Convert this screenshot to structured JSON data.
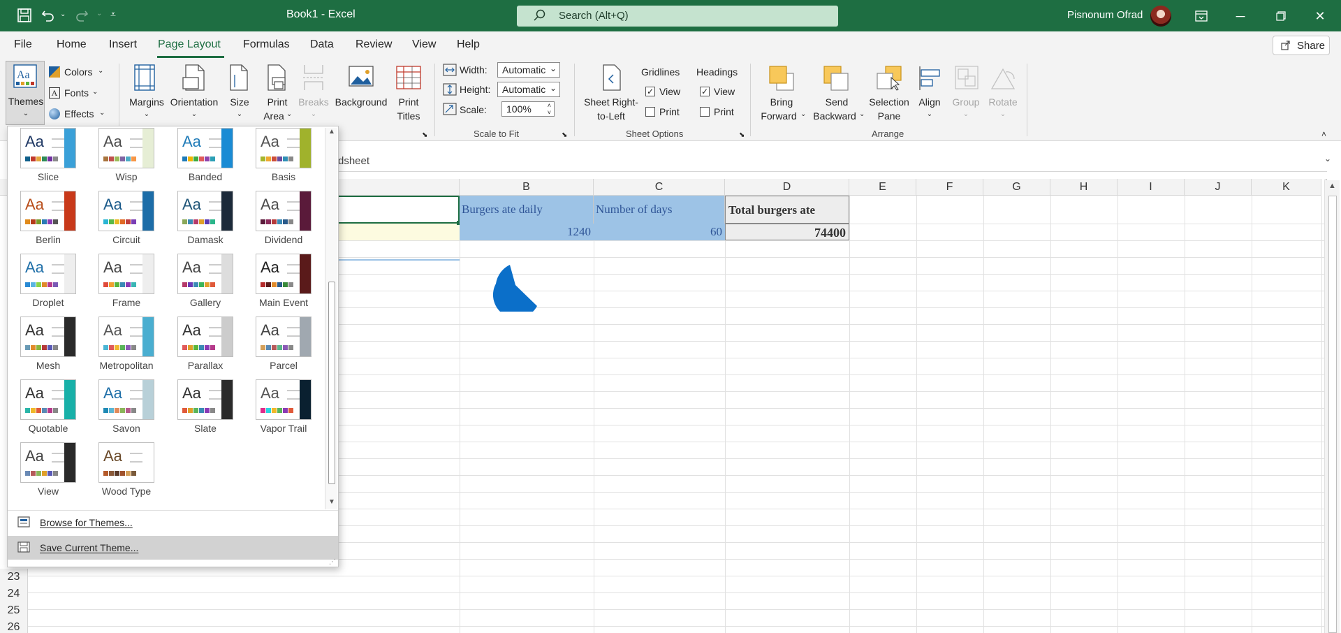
{
  "titlebar": {
    "title": "Book1  -  Excel",
    "search_placeholder": "Search (Alt+Q)",
    "user_name": "Pisnonum Ofrad"
  },
  "menu": {
    "tabs": [
      "File",
      "Home",
      "Insert",
      "Page Layout",
      "Formulas",
      "Data",
      "Review",
      "View",
      "Help"
    ],
    "active_tab": "Page Layout",
    "share_label": "Share"
  },
  "ribbon": {
    "themes": {
      "themes_label": "Themes",
      "colors_label": "Colors",
      "fonts_label": "Fonts",
      "effects_label": "Effects"
    },
    "page_setup": {
      "margins": "Margins",
      "orientation": "Orientation",
      "size": "Size",
      "print_area_1": "Print",
      "print_area_2": "Area",
      "breaks": "Breaks",
      "background": "Background",
      "print_titles_1": "Print",
      "print_titles_2": "Titles"
    },
    "scale_to_fit": {
      "width_label": "Width:",
      "width_value": "Automatic",
      "height_label": "Height:",
      "height_value": "Automatic",
      "scale_label": "Scale:",
      "scale_value": "100%",
      "group_label": "Scale to Fit"
    },
    "sheet_options": {
      "rtl_1": "Sheet Right-",
      "rtl_2": "to-Left",
      "gridlines": "Gridlines",
      "headings": "Headings",
      "view": "View",
      "print": "Print",
      "gridlines_view_checked": true,
      "gridlines_print_checked": false,
      "headings_view_checked": true,
      "headings_print_checked": false,
      "group_label": "Sheet Options"
    },
    "arrange": {
      "bring_1": "Bring",
      "bring_2": "Forward",
      "send_1": "Send",
      "send_2": "Backward",
      "sel_1": "Selection",
      "sel_2": "Pane",
      "align": "Align",
      "group": "Group",
      "rotate": "Rotate",
      "group_label": "Arrange"
    }
  },
  "formula_bar": {
    "content": "dsheet"
  },
  "grid": {
    "columns": [
      "B",
      "C",
      "D",
      "E",
      "F",
      "G",
      "H",
      "I",
      "J",
      "K"
    ],
    "visible_rows": [
      "23",
      "24",
      "25",
      "26"
    ],
    "cells": {
      "b1": "Burgers ate daily",
      "c1": "Number of days",
      "d1": "Total burgers ate",
      "b2": "1240",
      "c2": "60",
      "d2": "74400"
    }
  },
  "themes_panel": {
    "themes": [
      {
        "name": "Slice",
        "aa": "#1f3864",
        "side": "#3aa0d8",
        "colors": [
          "#0f5f8a",
          "#c0392b",
          "#e6a53a",
          "#2e8b57",
          "#7030a0",
          "#8a8a8a"
        ]
      },
      {
        "name": "Wisp",
        "aa": "#4d4d4d",
        "side": "#e6eed5",
        "colors": [
          "#a9743d",
          "#c0504d",
          "#9bbb59",
          "#8064a2",
          "#4bacc6",
          "#f79646"
        ]
      },
      {
        "name": "Banded",
        "aa": "#1f7bb8",
        "side": "#1a8bd4",
        "colors": [
          "#1f7bb8",
          "#f0b400",
          "#3eaa3e",
          "#e05a5a",
          "#8e44ad",
          "#2c9fb5"
        ]
      },
      {
        "name": "Basis",
        "aa": "#555555",
        "side": "#a0b22c",
        "colors": [
          "#a5b52c",
          "#f0a830",
          "#cc4e3b",
          "#6c4a9e",
          "#2f8fb5",
          "#888888"
        ]
      },
      {
        "name": "Berlin",
        "aa": "#b84d1a",
        "side": "#c8391a",
        "colors": [
          "#e08a1a",
          "#b53a1a",
          "#7a9a2a",
          "#2a7ab5",
          "#8a3ab5",
          "#555555"
        ]
      },
      {
        "name": "Circuit",
        "aa": "#1a5a8a",
        "side": "#1c6da8",
        "colors": [
          "#2ab5d4",
          "#57b847",
          "#e8b923",
          "#e06926",
          "#bf3e3e",
          "#7a3eb5"
        ]
      },
      {
        "name": "Damask",
        "aa": "#1f5577",
        "side": "#1c2a3a",
        "colors": [
          "#8aa85a",
          "#3a8ab5",
          "#b53a6a",
          "#e0a02a",
          "#5a3ab5",
          "#2ab58a"
        ]
      },
      {
        "name": "Dividend",
        "aa": "#4d4d4d",
        "side": "#5a1a3a",
        "colors": [
          "#5a1a3a",
          "#8a2a5a",
          "#b53a3a",
          "#3a8ab5",
          "#2a5a8a",
          "#888888"
        ]
      },
      {
        "name": "Droplet",
        "aa": "#1f6fa8",
        "side": "#eeeeee",
        "colors": [
          "#2a8ad4",
          "#5ab5e0",
          "#8ad44a",
          "#e08a2a",
          "#b53a8a",
          "#7a5ab5"
        ]
      },
      {
        "name": "Frame",
        "aa": "#444444",
        "side": "#eeeeee",
        "colors": [
          "#e04a3a",
          "#f0a030",
          "#5ab53a",
          "#3a8ab5",
          "#8a3ab5",
          "#3ab5b5"
        ]
      },
      {
        "name": "Gallery",
        "aa": "#444444",
        "side": "#dddddd",
        "colors": [
          "#b53a6a",
          "#6a3ab5",
          "#3a8ab5",
          "#3ab55a",
          "#e0a02a",
          "#e05a3a"
        ]
      },
      {
        "name": "Main Event",
        "aa": "#222222",
        "side": "#5a1a1a",
        "colors": [
          "#b52a2a",
          "#5a1a1a",
          "#e08a2a",
          "#2a5a8a",
          "#3a8a3a",
          "#8a8a8a"
        ]
      },
      {
        "name": "Mesh",
        "aa": "#333333",
        "side": "#2a2a2a",
        "colors": [
          "#6a9ab5",
          "#e08a2a",
          "#8ab53a",
          "#b53a3a",
          "#5a5ab5",
          "#888888"
        ]
      },
      {
        "name": "Metropolitan",
        "aa": "#555555",
        "side": "#4aaed0",
        "colors": [
          "#4ab5d4",
          "#e05a5a",
          "#f0b830",
          "#5ab55a",
          "#8a5ab5",
          "#888888"
        ]
      },
      {
        "name": "Parallax",
        "aa": "#333333",
        "side": "#cccccc",
        "colors": [
          "#e05a5a",
          "#e0a02a",
          "#5ab53a",
          "#3a8ab5",
          "#8a3ab5",
          "#b53a8a"
        ]
      },
      {
        "name": "Parcel",
        "aa": "#444444",
        "side": "#a0a8b0",
        "colors": [
          "#d4a05a",
          "#5a8ab5",
          "#b55a5a",
          "#5ab58a",
          "#8a5ab5",
          "#888888"
        ]
      },
      {
        "name": "Quotable",
        "aa": "#333333",
        "side": "#18b0a8",
        "colors": [
          "#2ab5a8",
          "#f0b82a",
          "#e05a3a",
          "#5a8ab5",
          "#b53a8a",
          "#888888"
        ]
      },
      {
        "name": "Savon",
        "aa": "#1f6fa8",
        "side": "#b8d0d8",
        "colors": [
          "#1f8ab5",
          "#5ab5d4",
          "#e08a5a",
          "#8ab55a",
          "#b55a8a",
          "#888888"
        ]
      },
      {
        "name": "Slate",
        "aa": "#333333",
        "side": "#2a2a2a",
        "colors": [
          "#e05a3a",
          "#e0a02a",
          "#5ab55a",
          "#3a8ab5",
          "#8a3ab5",
          "#888888"
        ]
      },
      {
        "name": "Vapor Trail",
        "aa": "#555555",
        "side": "#0a2030",
        "colors": [
          "#e02a8a",
          "#2ad4e0",
          "#f0b82a",
          "#5ab55a",
          "#8a3ab5",
          "#e05a3a"
        ]
      },
      {
        "name": "View",
        "aa": "#444444",
        "side": "#2a2a2a",
        "colors": [
          "#6a8ab5",
          "#b55a5a",
          "#8ab55a",
          "#e0a02a",
          "#5a5ab5",
          "#888888"
        ]
      },
      {
        "name": "Wood Type",
        "aa": "#6a4a2a",
        "side": "#ffffff",
        "colors": [
          "#b55a2a",
          "#8a5a3a",
          "#5a3a2a",
          "#a0522d",
          "#d4a05a",
          "#7a5a3a"
        ]
      }
    ],
    "browse_label": "Browse for Themes...",
    "save_label": "Save Current Theme..."
  },
  "colors": {
    "excel_green": "#1e6e42",
    "header_fill": "#9dc3e6",
    "header_text": "#2f5597",
    "total_fill": "#ededed",
    "selected_cell_fill": "#fdfbe0",
    "pie_fill": "#0b6fc9"
  }
}
